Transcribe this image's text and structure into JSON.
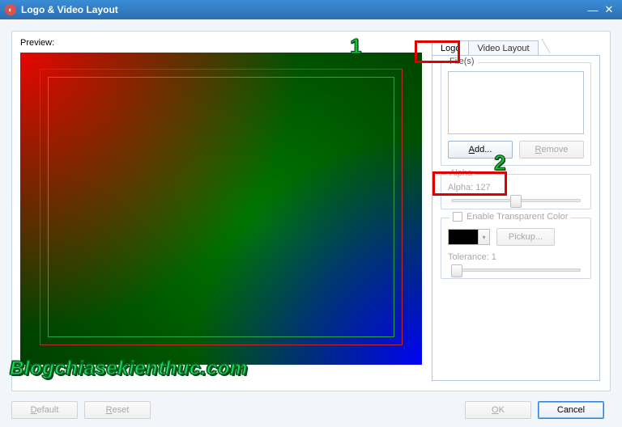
{
  "titlebar": {
    "title": "Logo & Video Layout"
  },
  "preview": {
    "label": "Preview:"
  },
  "overlay_watermark": "Blogchiasekienthuc.com",
  "tabs": {
    "logo": "Logo",
    "video_layout": "Video Layout"
  },
  "files": {
    "group_title": "File(s)",
    "add_label_prefix": "A",
    "add_label_rest": "dd...",
    "remove_label_prefix": "R",
    "remove_label_rest": "emove"
  },
  "alpha": {
    "group_title": "Alpha",
    "value_label": "Alpha: 127",
    "value": 127,
    "min": 0,
    "max": 255
  },
  "transp": {
    "enable_label": "Enable Transparent Color",
    "pickup_label": "Pickup...",
    "tolerance_label": "Tolerance: 1",
    "tolerance": 1,
    "tol_min": 0,
    "tol_max": 255,
    "color": "#000000"
  },
  "buttons": {
    "default_prefix": "D",
    "default_rest": "efault",
    "reset_prefix": "R",
    "reset_rest": "eset",
    "ok_prefix": "O",
    "ok_rest": "K",
    "cancel": "Cancel"
  },
  "markers": {
    "one": "1",
    "two": "2"
  }
}
